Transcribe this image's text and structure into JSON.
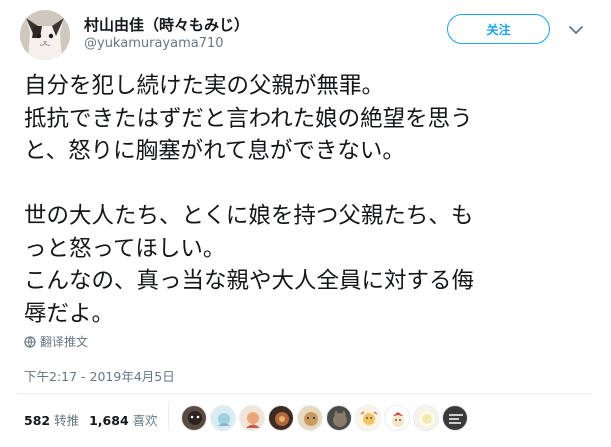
{
  "user": {
    "display_name": "村山由佳（時々もみじ）",
    "handle": "@yukamurayama710",
    "follow_label": "关注"
  },
  "tweet": {
    "lines_a": [
      "自分を犯し続けた実の父親が無罪。",
      "抵抗できたはずだと言われた娘の絶望を思う",
      "と、怒りに胸塞がれて息ができない。"
    ],
    "lines_b": [
      "世の大人たち、とくに娘を持つ父親たち、も",
      "っと怒ってほしい。",
      "こんなの、真っ当な親や大人全員に対する侮",
      "辱だよ。"
    ],
    "translate_label": "翻译推文",
    "timestamp": "下午2:17 - 2019年4月5日"
  },
  "stats": {
    "retweets_count": "582",
    "retweets_label": "转推",
    "likes_count": "1,684",
    "likes_label": "喜欢"
  },
  "colors": {
    "accent": "#1da1f2",
    "muted": "#657786",
    "text": "#14171a",
    "divider": "#e6ecf0"
  },
  "icons": {
    "globe": "globe-icon",
    "chevron": "chevron-down-icon"
  }
}
